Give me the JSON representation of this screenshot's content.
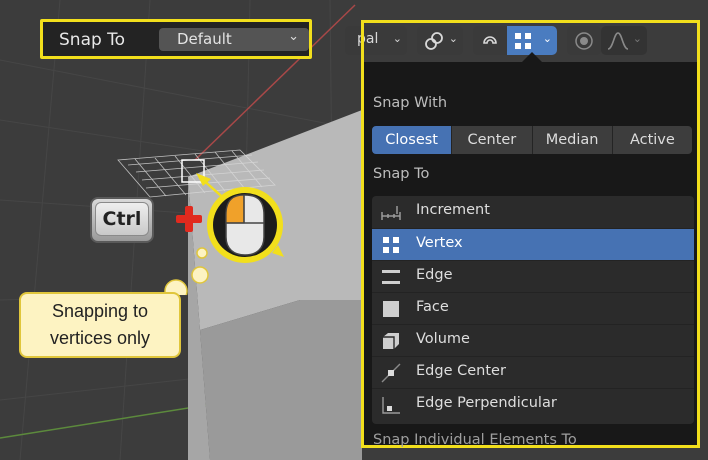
{
  "snap_to_bar": {
    "label": "Snap To",
    "value": "Default"
  },
  "toolbar": {
    "orientation_partial": "pal"
  },
  "popover": {
    "snap_with_title": "Snap With",
    "snap_with_options": [
      "Closest",
      "Center",
      "Median",
      "Active"
    ],
    "snap_with_selected": "Closest",
    "snap_to_title": "Snap To",
    "snap_to_items": [
      {
        "label": "Increment",
        "icon": "increment-icon"
      },
      {
        "label": "Vertex",
        "icon": "vertex-icon"
      },
      {
        "label": "Edge",
        "icon": "edge-icon"
      },
      {
        "label": "Face",
        "icon": "face-icon"
      },
      {
        "label": "Volume",
        "icon": "volume-icon"
      },
      {
        "label": "Edge Center",
        "icon": "edge-center-icon"
      },
      {
        "label": "Edge Perpendicular",
        "icon": "edge-perpendicular-icon"
      }
    ],
    "snap_to_selected": "Vertex",
    "footer_section_title": "Snap Individual Elements To"
  },
  "annotations": {
    "modifier_key": "Ctrl",
    "callout_line1": "Snapping to",
    "callout_line2": "vertices only"
  },
  "colors": {
    "highlight_border": "#f2df1c",
    "selection_blue": "#4672b3",
    "plus_red": "#e12a1e",
    "callout_fill": "#fdf3c2",
    "mouse_button_orange": "#f0a12a"
  }
}
